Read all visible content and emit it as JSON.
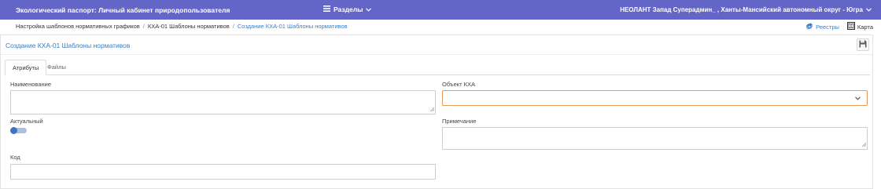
{
  "header": {
    "app_title": "Экологический паспорт: Личный кабинет природопользователя",
    "sections_label": "Разделы",
    "user_info": "НЕОЛАНТ Запад Суперадмин_ , Ханты-Мансийский автономный округ - Югра"
  },
  "breadcrumb": {
    "items": [
      "Настройка шаблонов нормативных графиков",
      "КХА-01 Шаблоны нормативов",
      "Создание КХА-01 Шаблоны нормативов"
    ],
    "separator": "/"
  },
  "top_actions": {
    "registries_label": "Реестры",
    "map_label": "Карта"
  },
  "panel": {
    "title": "Создание КХА-01 Шаблоны нормативов"
  },
  "tabs": [
    {
      "label": "Атрибуты",
      "active": true
    },
    {
      "label": "Файлы",
      "active": false
    }
  ],
  "form": {
    "name_label": "Наименование",
    "name_value": "",
    "active_label": "Актуальный",
    "active_value": true,
    "code_label": "Код",
    "code_value": "",
    "kha_object_label": "Объект КХА",
    "kha_object_value": "",
    "note_label": "Примечание",
    "note_value": ""
  },
  "colors": {
    "topbar": "#6366c6",
    "link": "#3a7ec2",
    "focus_border": "#e59b57",
    "toggle": "#3f73c4"
  },
  "icons": {
    "sections": "menu-icon",
    "registries": "registries-icon",
    "map": "map-icon",
    "save": "save-icon",
    "dropdown": "chevron-down-icon"
  }
}
